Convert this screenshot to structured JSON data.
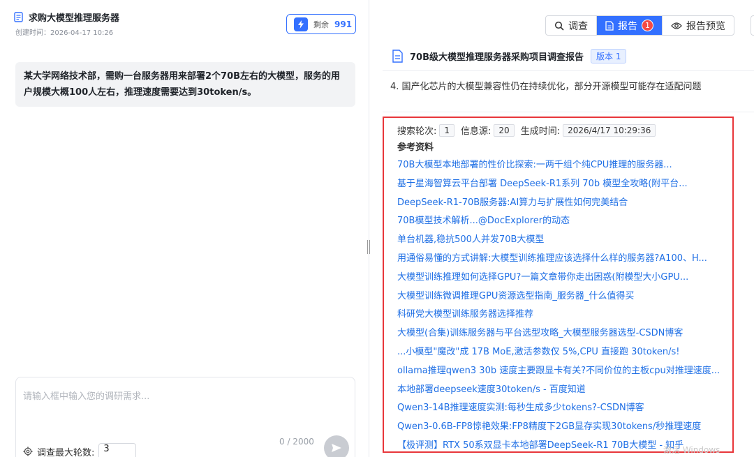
{
  "left": {
    "title": "求购大模型推理服务器",
    "created": "创建时间：2026-04-17 10:26",
    "remaining_label": "剩余",
    "remaining_value": "991",
    "message": "某大学网络技术部，需购一台服务器用来部署2个70B左右的大模型，服务的用户规模大概100人左右，推理速度需要达到30token/s。",
    "input_placeholder": "请输入框中输入您的调研需求...",
    "char_counter": "0 / 2000",
    "rounds_label": "调查最大轮数:",
    "rounds_value": "3"
  },
  "right": {
    "tabs": [
      {
        "label": "调查",
        "icon": "search-icon"
      },
      {
        "label": "报告",
        "icon": "document-icon",
        "badge": "1",
        "active": true
      },
      {
        "label": "报告预览",
        "icon": "eye-icon"
      }
    ],
    "report_title": "70B级大模型推理服务器采购项目调查报告",
    "version": "版本 1",
    "point4": "4. 国产化芯片的大模型兼容性仍在持续优化，部分开源模型可能存在适配问题",
    "meta": {
      "rounds_label": "搜索轮次:",
      "rounds_value": "1",
      "sources_label": "信息源:",
      "sources_value": "20",
      "time_label": "生成时间:",
      "time_value": "2026/4/17 10:29:36"
    },
    "references_title": "参考资料",
    "references": [
      "70B大模型本地部署的性价比探索:一两千组个纯CPU推理的服务器...",
      "基于星海智算云平台部署 DeepSeek-R1系列 70b 模型全攻略(附平台...",
      "DeepSeek-R1-70B服务器:AI算力与扩展性如何完美结合",
      "70B模型技术解析...@DocExplorer的动态",
      "单台机器,稳抗500人并发70B大模型",
      "用通俗易懂的方式讲解:大模型训练推理应该选择什么样的服务器?A100、H...",
      "大模型训练推理如何选择GPU?一篇文章带你走出困惑(附模型大小GPU...",
      "大模型训练微调推理GPU资源选型指南_服务器_什么值得买",
      "科研党大模型训练服务器选择推荐",
      "大模型(合集)训练服务器与平台选型攻略_大模型服务器选型-CSDN博客",
      "...小模型\"魔改\"成 17B MoE,激活参数仅 5%,CPU 直接跑 30token/s!",
      "ollama推理qwen3 30b 速度主要跟显卡有关?不同价位的主板cpu对推理速度...",
      "本地部署deepseek速度30token/s - 百度知道",
      "Qwen3-14B推理速度实测:每秒生成多少tokens?-CSDN博客",
      "Qwen3-0.6B-FP8惊艳效果:FP8精度下2GB显存实现30tokens/秒推理速度",
      "【极评测】RTX 50系双显卡本地部署DeepSeek-R1 70B大模型 - 知乎"
    ]
  },
  "watermark": "激活 Windows",
  "colors": {
    "accent": "#3370ff",
    "highlight_border": "#e8363a",
    "link": "#1f6fe5",
    "badge": "#f54a45"
  }
}
